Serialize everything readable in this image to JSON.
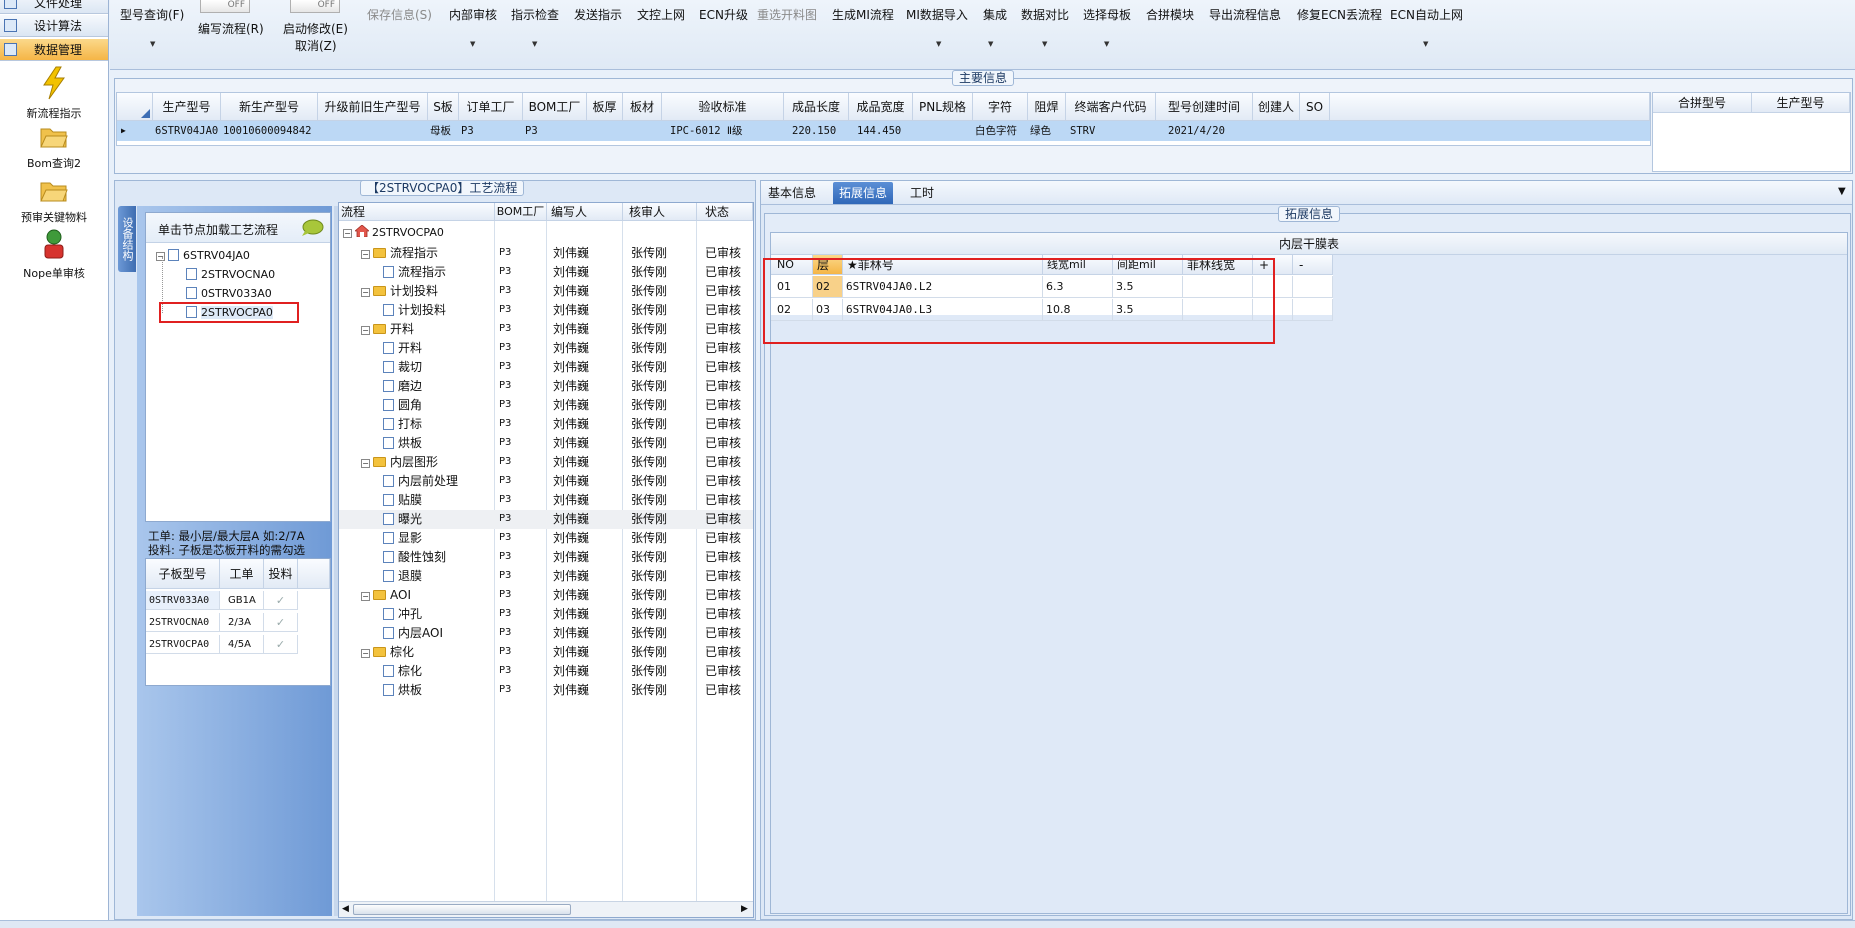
{
  "nav": {
    "items": [
      {
        "label": "文件处理"
      },
      {
        "label": "设计算法"
      },
      {
        "label": "数据管理"
      }
    ],
    "tools": [
      {
        "label": "新流程指示"
      },
      {
        "label": "Bom查询2"
      },
      {
        "label": "预审关键物料"
      },
      {
        "label": "Nope单审核"
      }
    ]
  },
  "toolbar": {
    "items": [
      {
        "label": "型号查询(F)"
      },
      {
        "label": "编写流程(R)"
      },
      {
        "label": "启动修改(E)"
      },
      {
        "label": "取消(Z)"
      },
      {
        "label": "保存信息(S)"
      },
      {
        "label": "内部审核"
      },
      {
        "label": "指示检查"
      },
      {
        "label": "发送指示"
      },
      {
        "label": "文控上网"
      },
      {
        "label": "ECN升级"
      },
      {
        "label": "重选开料图"
      },
      {
        "label": "生成MI流程"
      },
      {
        "label": "MI数据导入"
      },
      {
        "label": "集成"
      },
      {
        "label": "数据对比"
      },
      {
        "label": "选择母板"
      },
      {
        "label": "合拼模块"
      },
      {
        "label": "导出流程信息"
      },
      {
        "label": "修复ECN丢流程"
      },
      {
        "label": "ECN自动上网"
      }
    ],
    "toggle_off": "OFF"
  },
  "main_info": {
    "title": "主要信息",
    "columns": [
      "生产型号",
      "新生产型号",
      "升级前旧生产型号",
      "S板",
      "订单工厂",
      "BOM工厂",
      "板厚",
      "板材",
      "验收标准",
      "成品长度",
      "成品宽度",
      "PNL规格",
      "字符",
      "阻焊",
      "终端客户代码",
      "型号创建时间",
      "创建人",
      "SO"
    ],
    "row": [
      "6STRV04JA0",
      "10010600094842",
      "",
      "母板",
      "P3",
      "P3",
      "",
      "",
      "IPC-6012 Ⅱ级",
      "220.150",
      "144.450",
      "",
      "白色字符",
      "绿色",
      "STRV",
      "2021/4/20",
      "",
      ""
    ],
    "right_columns": [
      "合拼型号",
      "生产型号"
    ]
  },
  "process_panel": {
    "title": "【2STRVOCPA0】工艺流程",
    "side_tab": "设备结构",
    "hint": "单击节点加载工艺流程",
    "tree": [
      {
        "label": "6STRV04JA0"
      },
      {
        "label": "2STRVOCNA0"
      },
      {
        "label": "0STRV033A0"
      },
      {
        "label": "2STRVOCPA0"
      }
    ],
    "note_line1": "工单: 最小层/最大层A 如:2/7A",
    "note_line2": "投料: 子板是芯板开料的需勾选",
    "sub_columns": [
      "子板型号",
      "工单",
      "投料"
    ],
    "sub_rows": [
      {
        "model": "0STRV033A0",
        "order": "GB1A",
        "check": "✓"
      },
      {
        "model": "2STRVOCNA0",
        "order": "2/3A",
        "check": "✓"
      },
      {
        "model": "2STRVOCPA0",
        "order": "4/5A",
        "check": "✓"
      }
    ]
  },
  "flow": {
    "columns": [
      "流程",
      "BOM工厂",
      "编写人",
      "核审人",
      "状态"
    ],
    "root": "2STRVOCPA0",
    "rows": [
      {
        "name": "流程指示",
        "level": 1,
        "bom": "P3",
        "writer": "刘伟巍",
        "reviewer": "张传刚",
        "status": "已审核"
      },
      {
        "name": "流程指示",
        "level": 2,
        "bom": "P3",
        "writer": "刘伟巍",
        "reviewer": "张传刚",
        "status": "已审核"
      },
      {
        "name": "计划投料",
        "level": 1,
        "bom": "P3",
        "writer": "刘伟巍",
        "reviewer": "张传刚",
        "status": "已审核"
      },
      {
        "name": "计划投料",
        "level": 2,
        "bom": "P3",
        "writer": "刘伟巍",
        "reviewer": "张传刚",
        "status": "已审核"
      },
      {
        "name": "开料",
        "level": 1,
        "bom": "P3",
        "writer": "刘伟巍",
        "reviewer": "张传刚",
        "status": "已审核"
      },
      {
        "name": "开料",
        "level": 2,
        "bom": "P3",
        "writer": "刘伟巍",
        "reviewer": "张传刚",
        "status": "已审核"
      },
      {
        "name": "裁切",
        "level": 2,
        "bom": "P3",
        "writer": "刘伟巍",
        "reviewer": "张传刚",
        "status": "已审核"
      },
      {
        "name": "磨边",
        "level": 2,
        "bom": "P3",
        "writer": "刘伟巍",
        "reviewer": "张传刚",
        "status": "已审核"
      },
      {
        "name": "圆角",
        "level": 2,
        "bom": "P3",
        "writer": "刘伟巍",
        "reviewer": "张传刚",
        "status": "已审核"
      },
      {
        "name": "打标",
        "level": 2,
        "bom": "P3",
        "writer": "刘伟巍",
        "reviewer": "张传刚",
        "status": "已审核"
      },
      {
        "name": "烘板",
        "level": 2,
        "bom": "P3",
        "writer": "刘伟巍",
        "reviewer": "张传刚",
        "status": "已审核"
      },
      {
        "name": "内层图形",
        "level": 1,
        "bom": "P3",
        "writer": "刘伟巍",
        "reviewer": "张传刚",
        "status": "已审核"
      },
      {
        "name": "内层前处理",
        "level": 2,
        "bom": "P3",
        "writer": "刘伟巍",
        "reviewer": "张传刚",
        "status": "已审核"
      },
      {
        "name": "贴膜",
        "level": 2,
        "bom": "P3",
        "writer": "刘伟巍",
        "reviewer": "张传刚",
        "status": "已审核"
      },
      {
        "name": "曝光",
        "level": 2,
        "bom": "P3",
        "writer": "刘伟巍",
        "reviewer": "张传刚",
        "status": "已审核"
      },
      {
        "name": "显影",
        "level": 2,
        "bom": "P3",
        "writer": "刘伟巍",
        "reviewer": "张传刚",
        "status": "已审核"
      },
      {
        "name": "酸性蚀刻",
        "level": 2,
        "bom": "P3",
        "writer": "刘伟巍",
        "reviewer": "张传刚",
        "status": "已审核"
      },
      {
        "name": "退膜",
        "level": 2,
        "bom": "P3",
        "writer": "刘伟巍",
        "reviewer": "张传刚",
        "status": "已审核"
      },
      {
        "name": "AOI",
        "level": 1,
        "bom": "P3",
        "writer": "刘伟巍",
        "reviewer": "张传刚",
        "status": "已审核"
      },
      {
        "name": "冲孔",
        "level": 2,
        "bom": "P3",
        "writer": "刘伟巍",
        "reviewer": "张传刚",
        "status": "已审核"
      },
      {
        "name": "内层AOI",
        "level": 2,
        "bom": "P3",
        "writer": "刘伟巍",
        "reviewer": "张传刚",
        "status": "已审核"
      },
      {
        "name": "棕化",
        "level": 1,
        "bom": "P3",
        "writer": "刘伟巍",
        "reviewer": "张传刚",
        "status": "已审核"
      },
      {
        "name": "棕化",
        "level": 2,
        "bom": "P3",
        "writer": "刘伟巍",
        "reviewer": "张传刚",
        "status": "已审核"
      },
      {
        "name": "烘板",
        "level": 2,
        "bom": "P3",
        "writer": "刘伟巍",
        "reviewer": "张传刚",
        "status": "已审核"
      }
    ]
  },
  "tabs": [
    {
      "label": "基本信息"
    },
    {
      "label": "拓展信息"
    },
    {
      "label": "工时"
    }
  ],
  "ext": {
    "title": "拓展信息",
    "table_title": "内层干膜表",
    "columns": [
      "NO",
      "层",
      "★菲林号",
      "线宽mil",
      "间距mil",
      "菲林线宽",
      "+",
      "-"
    ],
    "rows": [
      [
        "01",
        "02",
        "6STRV04JA0.L2",
        "6.3",
        "3.5",
        "",
        "",
        ""
      ],
      [
        "02",
        "03",
        "6STRV04JA0.L3",
        "10.8",
        "3.5",
        "",
        "",
        ""
      ]
    ]
  }
}
